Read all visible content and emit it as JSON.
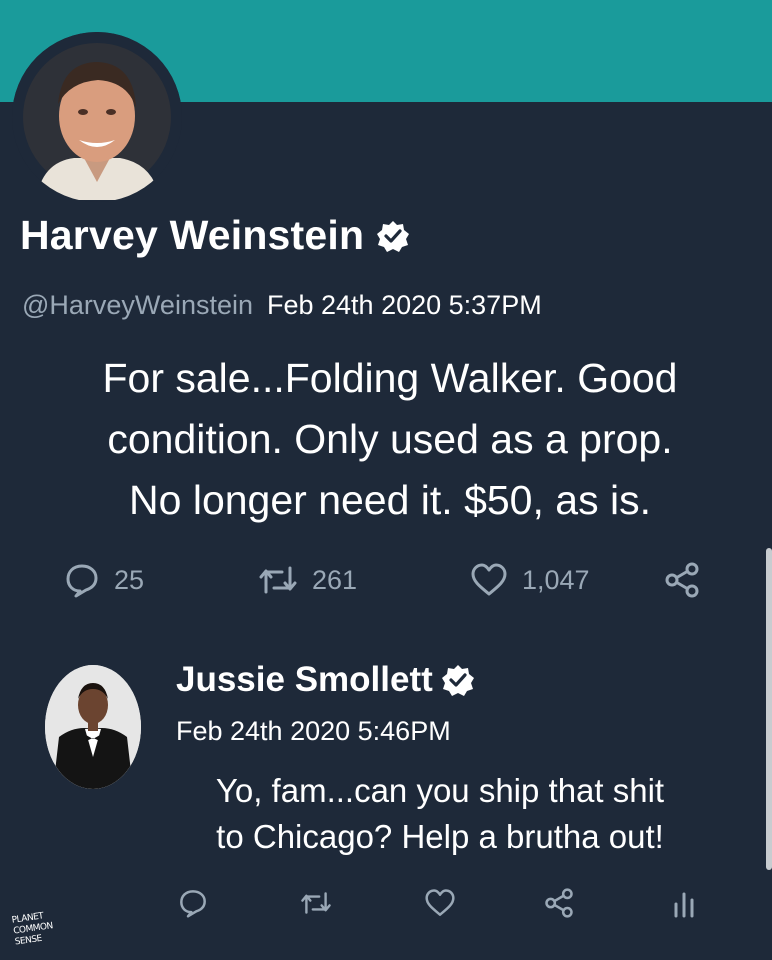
{
  "colors": {
    "background": "#1e2939",
    "banner": "#1a9b9b",
    "muted_text": "#9aa8b6",
    "text": "#ffffff"
  },
  "tweet": {
    "display_name": "Harvey Weinstein",
    "handle": "@HarveyWeinstein",
    "timestamp": "Feb 24th 2020 5:37PM",
    "verified": true,
    "text_lines": [
      "For sale...Folding Walker. Good",
      "condition. Only used as a prop.",
      "No longer need it. $50, as is."
    ],
    "actions": {
      "reply_count": "25",
      "retweet_count": "261",
      "like_count": "1,047"
    },
    "icons": [
      "comment-icon",
      "retweet-icon",
      "heart-icon",
      "share-icon",
      "verified-icon"
    ]
  },
  "reply": {
    "display_name": "Jussie Smollett",
    "timestamp": "Feb 24th 2020 5:46PM",
    "verified": true,
    "text_lines": [
      "Yo, fam...can you ship that shit",
      "to Chicago? Help a brutha out!"
    ],
    "icons": [
      "comment-icon",
      "retweet-icon",
      "heart-icon",
      "share-icon",
      "analytics-icon"
    ]
  },
  "watermark": {
    "lines": [
      "PLANET",
      "COMMON",
      "SENSE"
    ]
  }
}
